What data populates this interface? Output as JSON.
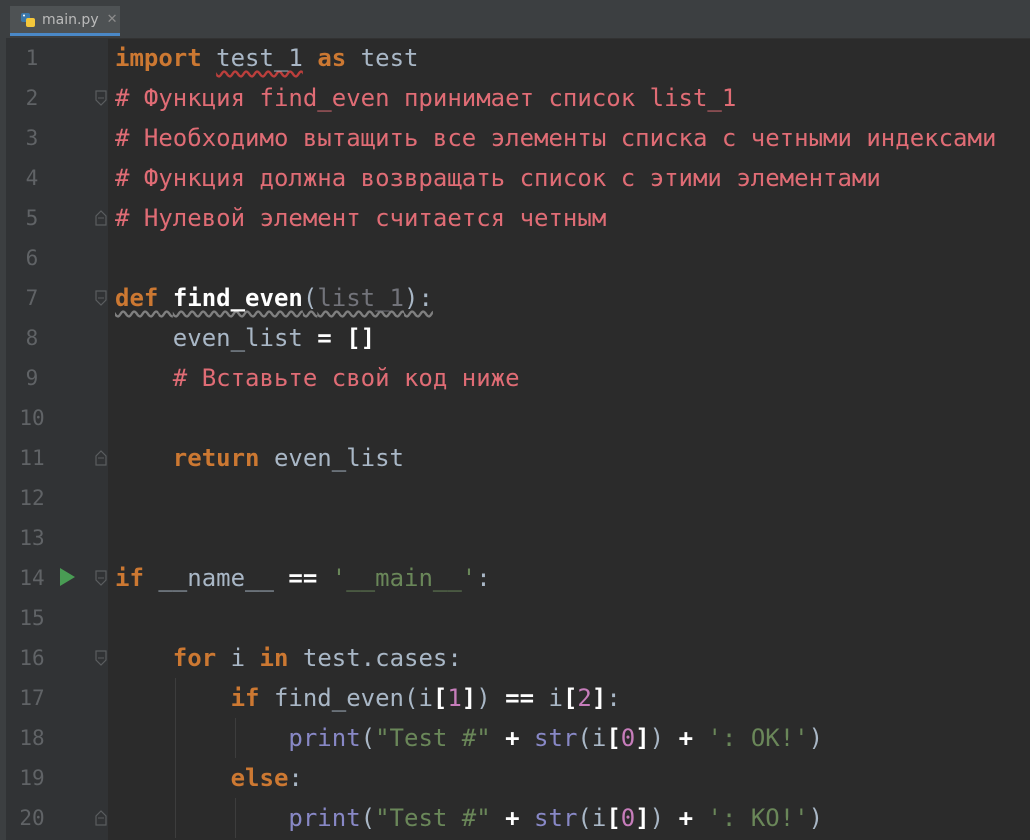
{
  "tab": {
    "label": "main.py",
    "close": "✕",
    "icon": "python-file-icon"
  },
  "colors": {
    "keyword": "#cc7832",
    "comment": "#e06c75",
    "string": "#6a8759",
    "number": "#6897bb",
    "run": "#499c54"
  },
  "code": {
    "lines": [
      {
        "n": "1",
        "fold": "",
        "tokens": [
          [
            "kw",
            "import"
          ],
          [
            "id",
            " "
          ],
          [
            "id",
            "test_1"
          ],
          [
            "id",
            " "
          ],
          [
            "kw",
            "as"
          ],
          [
            "id",
            " test"
          ]
        ]
      },
      {
        "n": "2",
        "fold": "start",
        "tokens": [
          [
            "cm",
            "# Функция find_even принимает список list_1"
          ]
        ]
      },
      {
        "n": "3",
        "fold": "",
        "tokens": [
          [
            "cm",
            "# Необходимо вытащить все элементы списка с четными индексами"
          ]
        ]
      },
      {
        "n": "4",
        "fold": "",
        "tokens": [
          [
            "cm",
            "# Функция должна возвращать список с этими элементами"
          ]
        ]
      },
      {
        "n": "5",
        "fold": "end",
        "tokens": [
          [
            "cm",
            "# Нулевой элемент считается четным"
          ]
        ]
      },
      {
        "n": "6",
        "fold": "",
        "tokens": []
      },
      {
        "n": "7",
        "fold": "start",
        "tokens": [
          [
            "kw",
            "def"
          ],
          [
            "id",
            " "
          ],
          [
            "fnb",
            "find_even"
          ],
          [
            "pu",
            "("
          ],
          [
            "par",
            "list_1"
          ],
          [
            "pu",
            "):"
          ]
        ]
      },
      {
        "n": "8",
        "fold": "",
        "tokens": [
          [
            "id",
            "    even_list "
          ],
          [
            "bold-white",
            "="
          ],
          [
            "id",
            " "
          ],
          [
            "bold-white",
            "[]"
          ]
        ]
      },
      {
        "n": "9",
        "fold": "",
        "tokens": [
          [
            "id",
            "    "
          ],
          [
            "cm",
            "# Вставьте свой код ниже"
          ]
        ]
      },
      {
        "n": "10",
        "fold": "",
        "tokens": []
      },
      {
        "n": "11",
        "fold": "end",
        "tokens": [
          [
            "id",
            "    "
          ],
          [
            "kw",
            "return"
          ],
          [
            "id",
            " even_list"
          ]
        ]
      },
      {
        "n": "12",
        "fold": "",
        "tokens": []
      },
      {
        "n": "13",
        "fold": "",
        "tokens": []
      },
      {
        "n": "14",
        "fold": "start",
        "run": true,
        "tokens": [
          [
            "kw",
            "if"
          ],
          [
            "id",
            " __name__ "
          ],
          [
            "bold-white",
            "=="
          ],
          [
            "id",
            " "
          ],
          [
            "st",
            "'__main__'"
          ],
          [
            "pu",
            ":"
          ]
        ]
      },
      {
        "n": "15",
        "fold": "",
        "tokens": []
      },
      {
        "n": "16",
        "fold": "start",
        "tokens": [
          [
            "id",
            "    "
          ],
          [
            "kw",
            "for"
          ],
          [
            "id",
            " i "
          ],
          [
            "kw",
            "in"
          ],
          [
            "id",
            " test.cases:"
          ]
        ]
      },
      {
        "n": "17",
        "fold": "",
        "tokens": [
          [
            "id",
            "        "
          ],
          [
            "kw",
            "if"
          ],
          [
            "id",
            " find_even(i"
          ],
          [
            "bold-white",
            "["
          ],
          [
            "mg",
            "1"
          ],
          [
            "bold-white",
            "]"
          ],
          [
            "id",
            ") "
          ],
          [
            "bold-white",
            "=="
          ],
          [
            "id",
            " i"
          ],
          [
            "bold-white",
            "["
          ],
          [
            "mg",
            "2"
          ],
          [
            "bold-white",
            "]"
          ],
          [
            "id",
            ":"
          ]
        ]
      },
      {
        "n": "18",
        "fold": "",
        "tokens": [
          [
            "id",
            "            "
          ],
          [
            "bi",
            "print"
          ],
          [
            "id",
            "("
          ],
          [
            "st",
            "\"Test #\""
          ],
          [
            "id",
            " "
          ],
          [
            "bold-white",
            "+"
          ],
          [
            "id",
            " "
          ],
          [
            "bi",
            "str"
          ],
          [
            "id",
            "(i"
          ],
          [
            "bold-white",
            "["
          ],
          [
            "mg",
            "0"
          ],
          [
            "bold-white",
            "]"
          ],
          [
            "id",
            ") "
          ],
          [
            "bold-white",
            "+"
          ],
          [
            "id",
            " "
          ],
          [
            "st",
            "': OK!'"
          ],
          [
            "id",
            ")"
          ]
        ]
      },
      {
        "n": "19",
        "fold": "",
        "tokens": [
          [
            "id",
            "        "
          ],
          [
            "kw",
            "else"
          ],
          [
            "id",
            ":"
          ]
        ]
      },
      {
        "n": "20",
        "fold": "end",
        "tokens": [
          [
            "id",
            "            "
          ],
          [
            "bi",
            "print"
          ],
          [
            "id",
            "("
          ],
          [
            "st",
            "\"Test #\""
          ],
          [
            "id",
            " "
          ],
          [
            "bold-white",
            "+"
          ],
          [
            "id",
            " "
          ],
          [
            "bi",
            "str"
          ],
          [
            "id",
            "(i"
          ],
          [
            "bold-white",
            "["
          ],
          [
            "mg",
            "0"
          ],
          [
            "bold-white",
            "]"
          ],
          [
            "id",
            ") "
          ],
          [
            "bold-white",
            "+"
          ],
          [
            "id",
            " "
          ],
          [
            "st",
            "': KO!'"
          ],
          [
            "id",
            ")"
          ]
        ]
      }
    ]
  }
}
